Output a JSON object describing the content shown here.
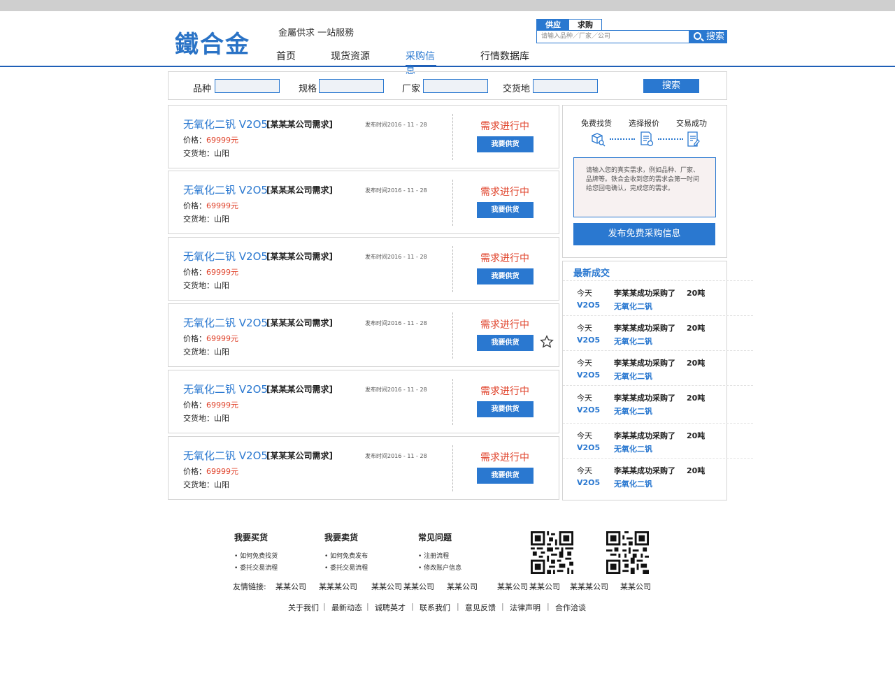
{
  "header": {
    "logo": "鐵合金",
    "slogan": "金屬供求 一站服務",
    "nav": [
      "首页",
      "现货资源",
      "采购信息",
      "行情数据库"
    ],
    "active_nav": "采购信息"
  },
  "search": {
    "tabs": [
      "供应",
      "求购"
    ],
    "placeholder": "请输入品种／厂家／公司",
    "button": "搜索"
  },
  "filter": {
    "labels": [
      "品种",
      "规格",
      "厂家",
      "交货地"
    ],
    "button": "搜索"
  },
  "listings": [
    {
      "title": "无氧化二钒 V2O5",
      "company": "[某某某公司需求]",
      "date": "发布时间2016 - 11 - 28",
      "price_label": "价格：",
      "price": "69999元",
      "place": "交货地：山阳",
      "status": "需求进行中",
      "button": "我要供货"
    },
    {
      "title": "无氧化二钒 V2O5",
      "company": "[某某某公司需求]",
      "date": "发布时间2016 - 11 - 28",
      "price_label": "价格：",
      "price": "69999元",
      "place": "交货地：山阳",
      "status": "需求进行中",
      "button": "我要供货"
    },
    {
      "title": "无氧化二钒 V2O5",
      "company": "[某某某公司需求]",
      "date": "发布时间2016 - 11 - 28",
      "price_label": "价格：",
      "price": "69999元",
      "place": "交货地：山阳",
      "status": "需求进行中",
      "button": "我要供货"
    },
    {
      "title": "无氧化二钒 V2O5",
      "company": "[某某某公司需求]",
      "date": "发布时间2016 - 11 - 28",
      "price_label": "价格：",
      "price": "69999元",
      "place": "交货地：山阳",
      "status": "需求进行中",
      "button": "我要供货"
    },
    {
      "title": "无氧化二钒 V2O5",
      "company": "[某某某公司需求]",
      "date": "发布时间2016 - 11 - 28",
      "price_label": "价格：",
      "price": "69999元",
      "place": "交货地：山阳",
      "status": "需求进行中",
      "button": "我要供货"
    },
    {
      "title": "无氧化二钒 V2O5",
      "company": "[某某某公司需求]",
      "date": "发布时间2016 - 11 - 28",
      "price_label": "价格：",
      "price": "69999元",
      "place": "交货地：山阳",
      "status": "需求进行中",
      "button": "我要供货"
    }
  ],
  "sidebar": {
    "steps": [
      "免费找货",
      "选择报价",
      "交易成功"
    ],
    "note": "请输入您的真实需求，例如品种、厂家、品牌等。铁合金收到您的需求会第一时间给您回电确认，完成您的需求。",
    "publish_button": "发布免费采购信息"
  },
  "deals": {
    "title": "最新成交",
    "rows": [
      {
        "day": "今天",
        "buyer": "李某某成功采购了",
        "qty": "20吨",
        "code": "V2O5",
        "name": "无氧化二钒"
      },
      {
        "day": "今天",
        "buyer": "李某某成功采购了",
        "qty": "20吨",
        "code": "V2O5",
        "name": "无氧化二钒"
      },
      {
        "day": "今天",
        "buyer": "李某某成功采购了",
        "qty": "20吨",
        "code": "V2O5",
        "name": "无氧化二钒"
      },
      {
        "day": "今天",
        "buyer": "李某某成功采购了",
        "qty": "20吨",
        "code": "V2O5",
        "name": "无氧化二钒"
      },
      {
        "day": "今天",
        "buyer": "李某某成功采购了",
        "qty": "20吨",
        "code": "V2O5",
        "name": "无氧化二钒"
      },
      {
        "day": "今天",
        "buyer": "李某某成功采购了",
        "qty": "20吨",
        "code": "V2O5",
        "name": "无氧化二钒"
      }
    ]
  },
  "footer": {
    "columns": [
      {
        "title": "我要买货",
        "items": [
          "如何免费找货",
          "委托交易流程"
        ]
      },
      {
        "title": "我要卖货",
        "items": [
          "如何免费发布",
          "委托交易流程"
        ]
      },
      {
        "title": "常见问题",
        "items": [
          "注册流程",
          "修改账户信息"
        ]
      }
    ],
    "links_label": "友情链接:",
    "links": [
      "某某公司",
      "某某某公司",
      "某某公司",
      "某某公司",
      "某某公司",
      "某某公司",
      "某某公司",
      "某某某公司",
      "某某公司"
    ],
    "bottom": [
      "关于我们",
      "最新动态",
      "诚聘英才",
      "联系我们",
      "意见反馈",
      "法律声明",
      "合作洽谈"
    ]
  },
  "colors": {
    "accent": "#2a78d0",
    "status": "#e0432b",
    "nav_line": "#1f5fb7"
  }
}
